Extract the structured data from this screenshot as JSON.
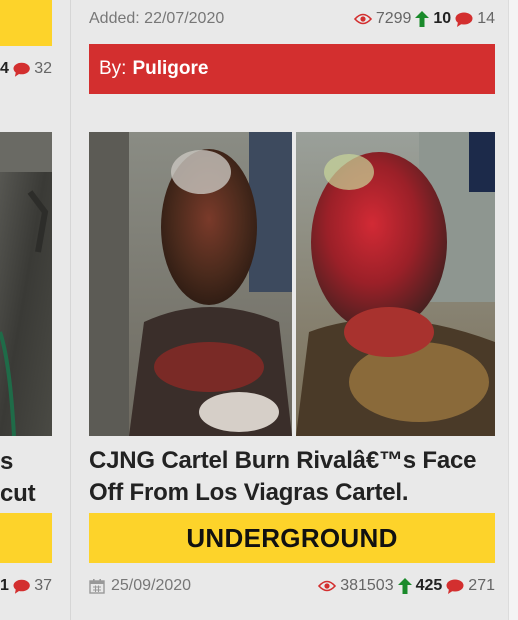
{
  "left_card": {
    "title_fragment": "s cut",
    "top_stats": {
      "upvotes_fragment": "4",
      "comments": "32"
    },
    "bottom_stats": {
      "upvotes_fragment": "1",
      "comments": "37"
    }
  },
  "card_top": {
    "added_label": "Added:",
    "added_date": "22/07/2020",
    "views": "7299",
    "upvotes": "10",
    "comments": "14",
    "author_prefix": "By:",
    "author": "Puligore"
  },
  "card_main": {
    "image_alt": "Video thumbnail",
    "title": "CJNG Cartel Burn Rivalâ€™s Face Off From Los Viagras Cartel.",
    "category": "UNDERGROUND",
    "date": "25/09/2020",
    "views": "381503",
    "upvotes": "425",
    "comments": "271"
  },
  "icons": {
    "views": "eye-icon",
    "upvotes": "arrow-up-icon",
    "comments": "comment-icon",
    "date": "calendar-icon"
  },
  "colors": {
    "author_bar": "#d32f2f",
    "category_bar": "#fdd32a",
    "upvote": "#1a8a2b",
    "icon_red": "#d32f2f"
  }
}
